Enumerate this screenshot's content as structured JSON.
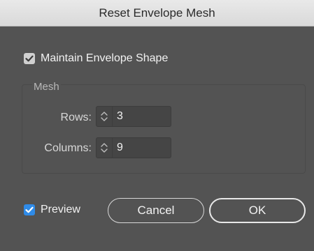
{
  "dialog": {
    "title": "Reset Envelope Mesh",
    "maintain_label": "Maintain Envelope Shape",
    "maintain_checked": true,
    "mesh_group_label": "Mesh",
    "rows_label": "Rows:",
    "rows_value": "3",
    "columns_label": "Columns:",
    "columns_value": "9",
    "preview_label": "Preview",
    "preview_checked": true,
    "cancel_label": "Cancel",
    "ok_label": "OK"
  },
  "colors": {
    "background": "#535353",
    "accent": "#2f8be8"
  },
  "icons": {
    "checkmark": "checkmark-icon",
    "stepper": "stepper-arrows-icon"
  }
}
